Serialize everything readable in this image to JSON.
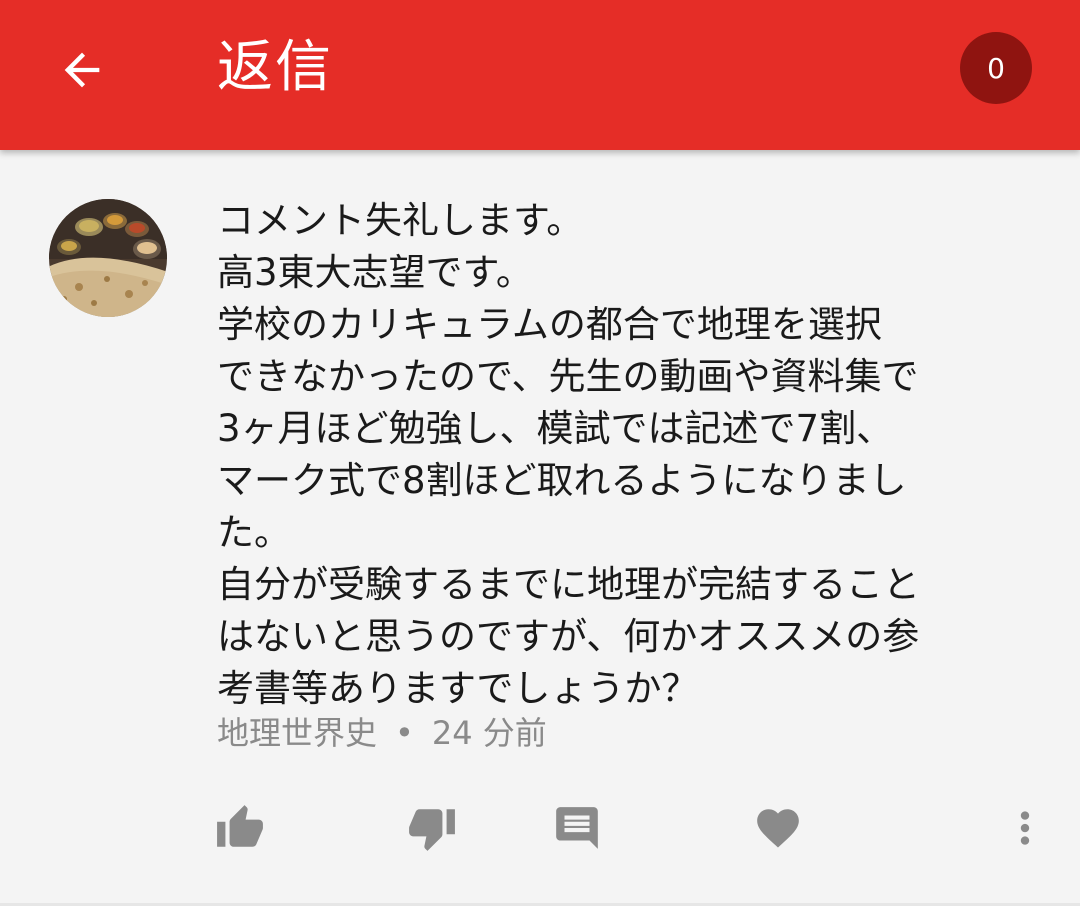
{
  "app_bar": {
    "title": "返信",
    "reply_count": "0",
    "color": "#e52d27",
    "badge_color": "#8f1410",
    "back_icon": "arrow-back-icon"
  },
  "comment": {
    "text": "コメント失礼します。\n高3東大志望です。\n学校のカリキュラムの都合で地理を選択\nできなかったので、先生の動画や資料集で\n3ヶ月ほど勉強し、模試では記述で7割、\nマーク式で8割ほど取れるようになりまし\nた。\n自分が受験するまでに地理が完結すること\nはないと思うのですが、何かオススメの参\n考書等ありますでしょうか？",
    "author": "地理世界史",
    "separator": "•",
    "time": "24 分前"
  },
  "actions": [
    {
      "name": "like-button",
      "icon": "thumb-up-icon"
    },
    {
      "name": "dislike-button",
      "icon": "thumb-down-icon"
    },
    {
      "name": "reply-button",
      "icon": "comment-icon"
    },
    {
      "name": "heart-button",
      "icon": "heart-icon"
    },
    {
      "name": "more-button",
      "icon": "more-vert-icon"
    }
  ]
}
